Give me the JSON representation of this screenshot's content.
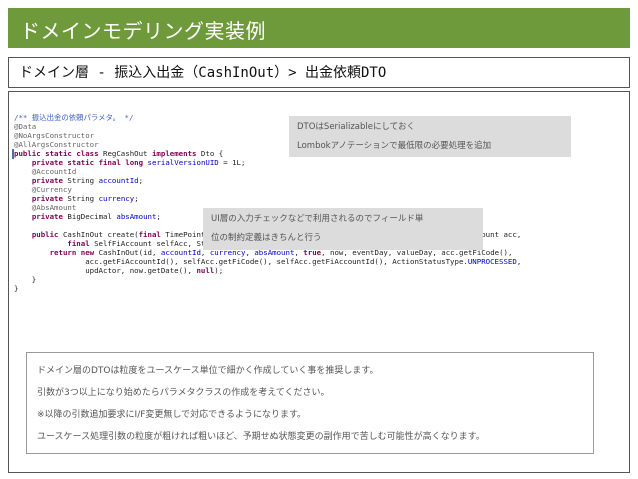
{
  "slide": {
    "title": "ドメインモデリング実装例",
    "subtitle": "ドメイン層 - 振込入出金（CashInOut）> 出金依頼DTO"
  },
  "code": {
    "lines": [
      "/** 振込出金の依頼パラメタ。 */",
      "@Data",
      "@NoArgsConstructor",
      "@AllArgsConstructor",
      "public static class RegCashOut implements Dto {",
      "    private static final long serialVersionUID = 1L;",
      "    @AccountId",
      "    private String accountId;",
      "    @Currency",
      "    private String currency;",
      "    @AbsAmount",
      "    private BigDecimal absAmount;",
      "",
      "    public CashInOut create(final TimePoint now, String id, String eventDay, String valueDay, final FiAccount acc,",
      "            final SelfFiAccount selfAcc, String updActor) {",
      "        return new CashInOut(id, accountId, currency, absAmount, true, now, eventDay, valueDay, acc.getFiCode(),",
      "                acc.getFiAccountId(), selfAcc.getFiCode(), selfAcc.getFiAccountId(), ActionStatusType.UNPROCESSED,",
      "                updActor, now.getDate(), null);",
      "    }",
      "}"
    ],
    "colors": {
      "keyword": "#7f0055",
      "annotation": "#646464",
      "comment": "#3f5fbf",
      "field": "#0000c0",
      "text": "#222222",
      "title_bar": "#6f9a3c"
    }
  },
  "callouts": [
    {
      "line1": "DTOはSerializableにしておく",
      "line2": "Lombokアノテーションで最低限の必要処理を追加"
    },
    {
      "line1": "UI層の入力チェックなどで利用されるのでフィールド単",
      "line2": "位の制約定義はきちんと行う"
    }
  ],
  "notes": [
    "ドメイン層のDTOは粒度をユースケース単位で細かく作成していく事を推奨します。",
    "引数が3つ以上になり始めたらパラメタクラスの作成を考えてください。",
    "※以降の引数追加要求にI/F変更無しで対応できるようになります。",
    "ユースケース処理引数の粒度が粗ければ粗いほど、予期せぬ状態変更の副作用で苦しむ可能性が高くなります。"
  ]
}
